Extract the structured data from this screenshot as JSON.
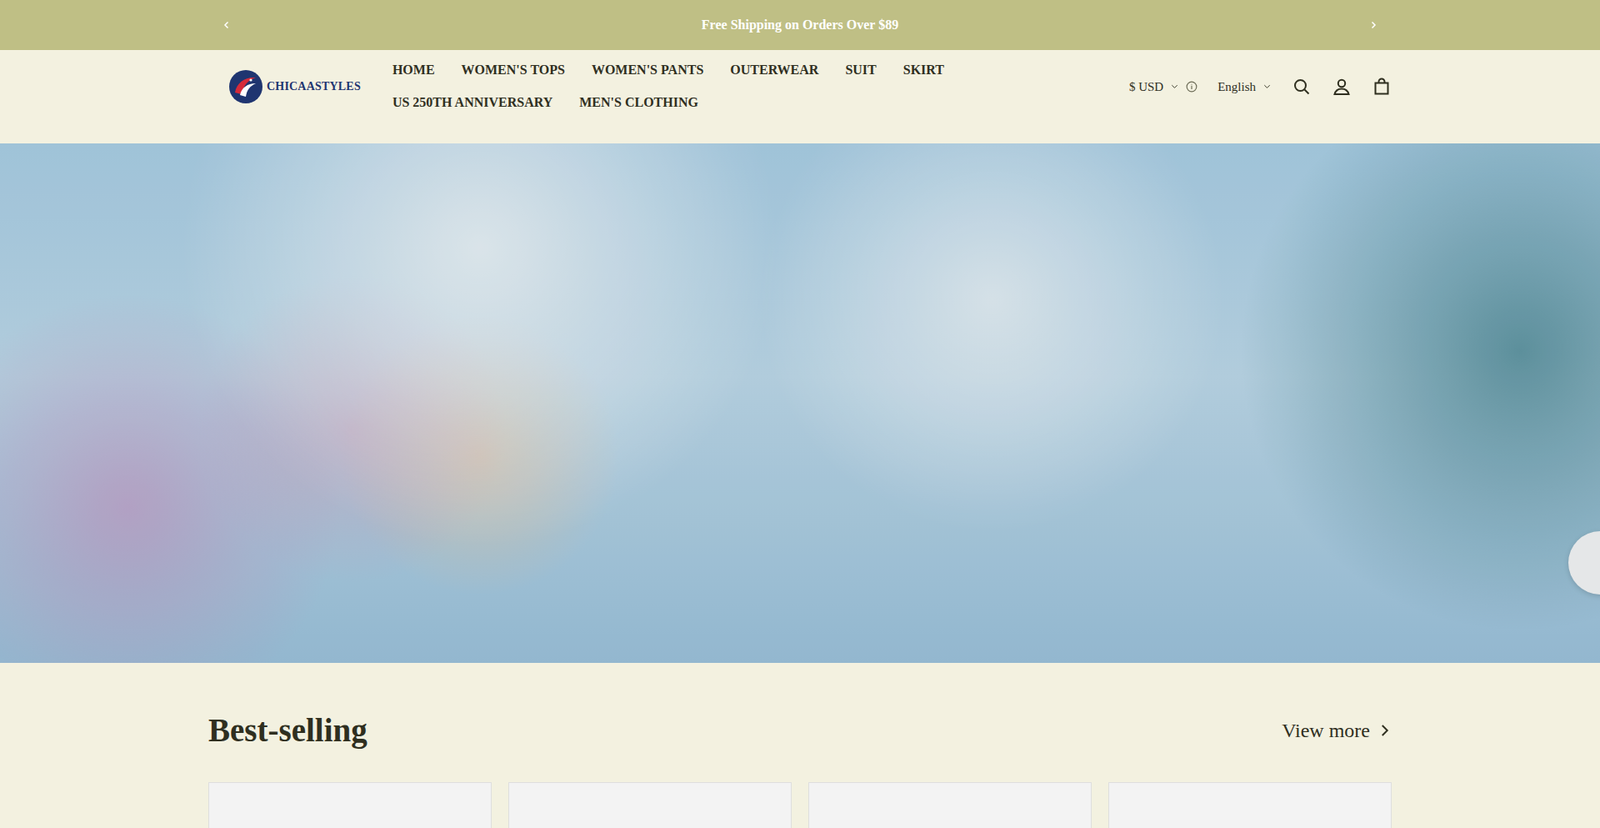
{
  "announcement": {
    "text": "Free Shipping on Orders Over $89"
  },
  "logo": {
    "text": "CHICAASTYLES"
  },
  "nav": [
    {
      "label": "HOME"
    },
    {
      "label": "WOMEN'S TOPS"
    },
    {
      "label": "WOMEN'S PANTS"
    },
    {
      "label": "OUTERWEAR"
    },
    {
      "label": "SUIT"
    },
    {
      "label": "SKIRT"
    },
    {
      "label": "US 250TH ANNIVERSARY"
    },
    {
      "label": "MEN'S CLOTHING"
    }
  ],
  "currency": "$ USD",
  "language": "English",
  "section": {
    "title": "Best-selling",
    "link": "View more"
  },
  "products": [
    {},
    {},
    {},
    {}
  ]
}
